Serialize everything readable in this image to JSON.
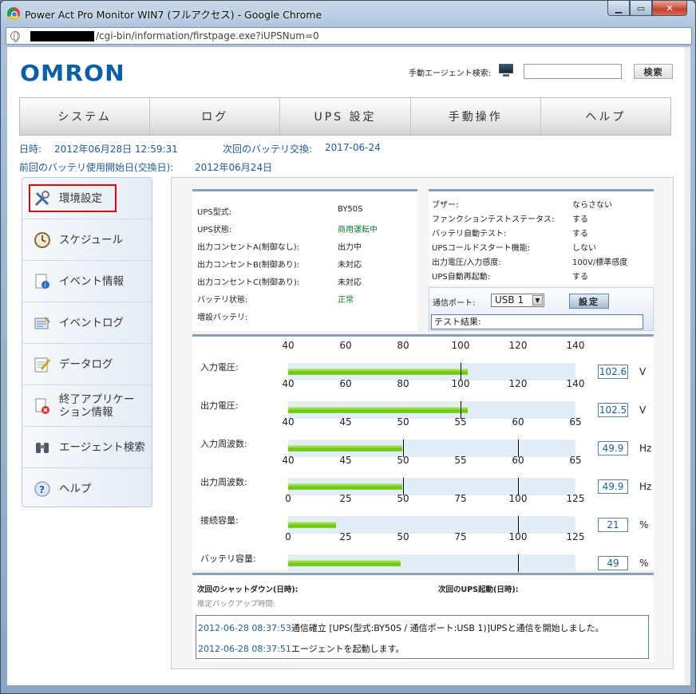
{
  "window": {
    "title": "Power Act Pro Monitor WIN7 (フルアクセス) - Google Chrome",
    "url": "/cgi-bin/information/firstpage.exe?iUPSNum=0"
  },
  "header": {
    "logo": "OMRON",
    "agent_search_label": "手動エージェント検索:",
    "search_button": "検索"
  },
  "nav": [
    "システム",
    "ログ",
    "UPS 設定",
    "手動操作",
    "ヘルプ"
  ],
  "info": {
    "datetime_label": "日時:",
    "datetime_value": "2012年06月28日 12:59:31",
    "next_battery_label": "次回のバッテリ交換:",
    "next_battery_value": "2017-06-24",
    "battery_start_label": "前回のバッテリ使用開始日(交換日):",
    "battery_start_value": "2012年06月24日"
  },
  "sidebar": [
    {
      "label": "環境設定",
      "icon": "tools-icon"
    },
    {
      "label": "スケジュール",
      "icon": "clock-icon"
    },
    {
      "label": "イベント情報",
      "icon": "info-document-icon"
    },
    {
      "label": "イベントログ",
      "icon": "log-icon"
    },
    {
      "label": "データログ",
      "icon": "edit-document-icon"
    },
    {
      "label": "終了アプリケー",
      "label2": "ション情報",
      "icon": "app-close-icon"
    },
    {
      "label": "エージェント検索",
      "icon": "binoculars-icon"
    },
    {
      "label": "ヘルプ",
      "icon": "help-icon"
    }
  ],
  "status_left": [
    {
      "label": "UPS型式:",
      "value": "BY50S"
    },
    {
      "label": "UPS状態:",
      "value": "商用運転中"
    },
    {
      "label": "出力コンセントA(制御なし):",
      "value": "出力中"
    },
    {
      "label": "出力コンセントB(制御あり):",
      "value": "未対応"
    },
    {
      "label": "出力コンセントC(制御あり):",
      "value": "未対応"
    },
    {
      "label": "バッテリ状態:",
      "value": "正常"
    },
    {
      "label": "増設バッテリ:",
      "value": ""
    }
  ],
  "status_right": [
    {
      "label": "ブザー:",
      "value": "ならさない"
    },
    {
      "label": "ファンクションテストステータス:",
      "value": "する"
    },
    {
      "label": "バッテリ自動テスト:",
      "value": "する"
    },
    {
      "label": "UPSコールドスタート機能:",
      "value": "しない"
    },
    {
      "label": "出力電圧/入力感度:",
      "value": "100V/標準感度"
    },
    {
      "label": "UPS自動再起動:",
      "value": "する"
    }
  ],
  "port": {
    "label": "通信ポート:",
    "selected": "USB 1",
    "set_button": "設定",
    "test_result_label": "テスト結果:"
  },
  "meters": [
    {
      "label": "入力電圧:",
      "ticks": [
        "40",
        "60",
        "80",
        "100",
        "120",
        "140"
      ],
      "min": 40,
      "max": 140,
      "value": 102.6,
      "display": "102.6",
      "marker": 100,
      "unit": "V"
    },
    {
      "label": "出力電圧:",
      "ticks": [
        "40",
        "60",
        "80",
        "100",
        "120",
        "140"
      ],
      "min": 40,
      "max": 140,
      "value": 102.5,
      "display": "102.5",
      "marker": 100,
      "unit": "V"
    },
    {
      "label": "入力周波数:",
      "ticks": [
        "40",
        "45",
        "50",
        "55",
        "60",
        "65"
      ],
      "min": 40,
      "max": 65,
      "value": 49.9,
      "display": "49.9",
      "marker": 50,
      "marker2": 60,
      "unit": "Hz"
    },
    {
      "label": "出力周波数:",
      "ticks": [
        "40",
        "45",
        "50",
        "55",
        "60",
        "65"
      ],
      "min": 40,
      "max": 65,
      "value": 49.9,
      "display": "49.9",
      "marker": 50,
      "marker2": 60,
      "unit": "Hz"
    },
    {
      "label": "接続容量:",
      "ticks": [
        "0",
        "25",
        "50",
        "75",
        "100",
        "125"
      ],
      "min": 0,
      "max": 125,
      "value": 21,
      "display": "21",
      "marker": 100,
      "unit": "%"
    },
    {
      "label": "バッテリ容量:",
      "ticks": [
        "0",
        "25",
        "50",
        "75",
        "100",
        "125"
      ],
      "min": 0,
      "max": 125,
      "value": 49,
      "display": "49",
      "marker": 100,
      "unit": "%"
    }
  ],
  "schedule": {
    "next_shutdown_label": "次回のシャットダウン(日時):",
    "next_startup_label": "次回のUPS起動(日時):",
    "backup_time_label": "推定バックアップ時間:"
  },
  "logs": [
    {
      "time": "2012-06-28 08:37:53",
      "message": "通信確立 [UPS(型式:BY50S / 通信ポート:USB 1)]UPSと通信を開始しました。"
    },
    {
      "time": "2012-06-28 08:37:51",
      "message": "エージェントを起動します。"
    }
  ]
}
